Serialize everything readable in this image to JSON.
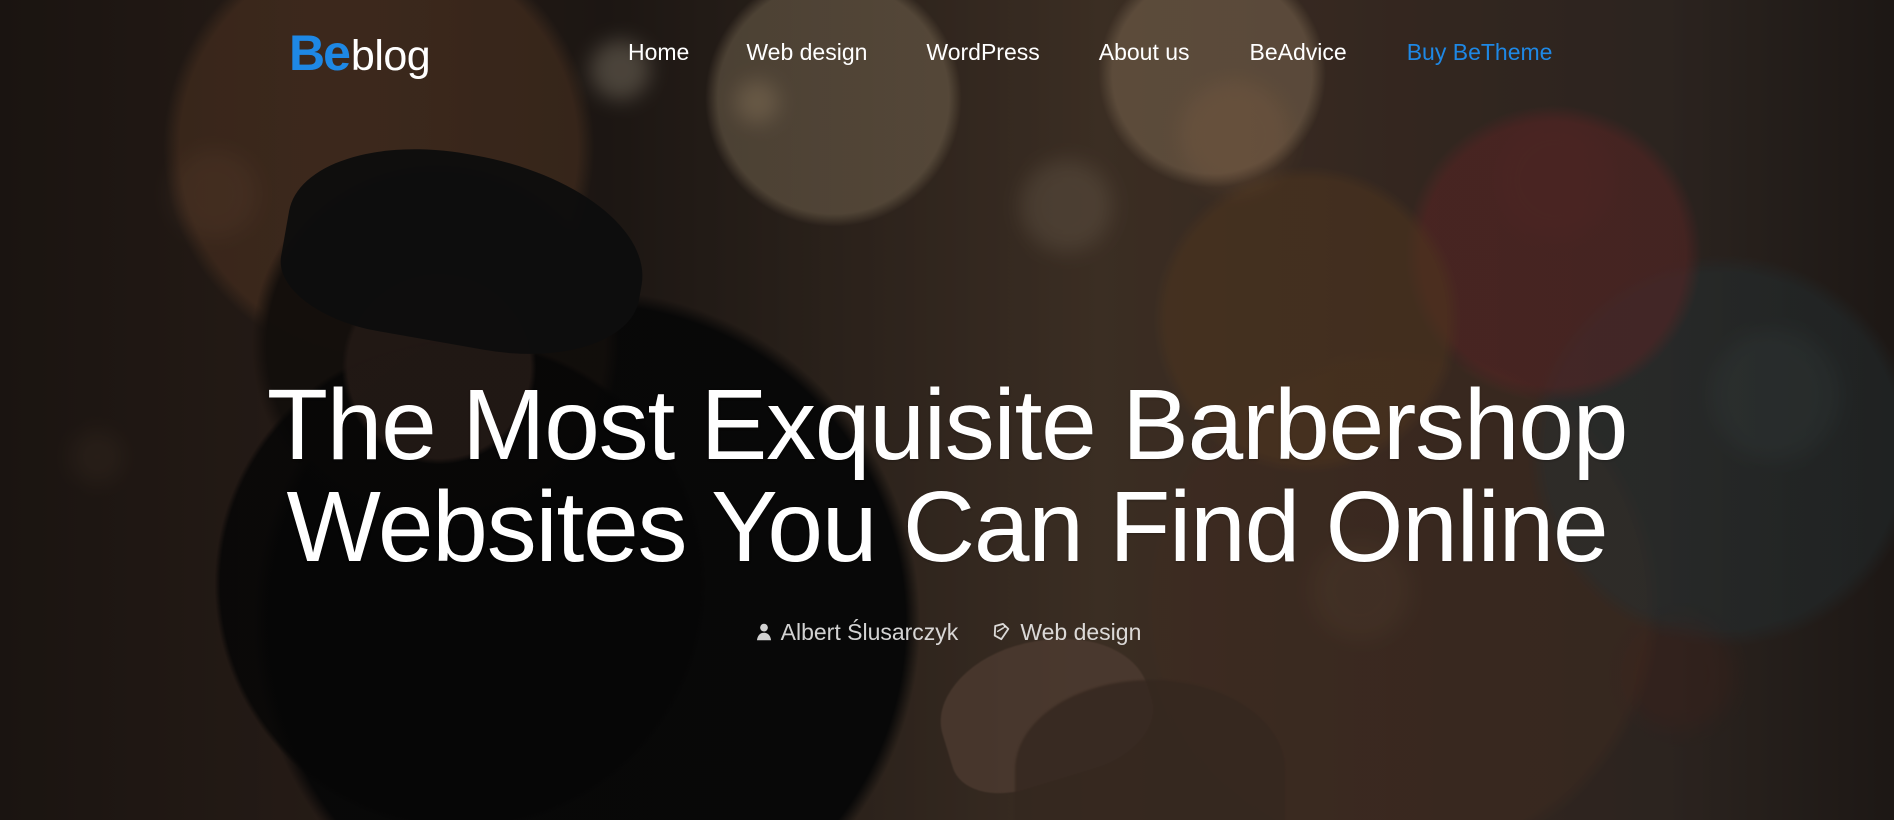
{
  "brand": {
    "logo_primary": "Be",
    "logo_secondary": "blog",
    "accent_color": "#1E88E5"
  },
  "nav": {
    "items": [
      {
        "label": "Home"
      },
      {
        "label": "Web design"
      },
      {
        "label": "WordPress"
      },
      {
        "label": "About us"
      },
      {
        "label": "BeAdvice"
      },
      {
        "label": "Buy BeTheme"
      }
    ]
  },
  "hero": {
    "title_line_1": "The Most Exquisite Barbershop",
    "title_line_2": "Websites You Can Find Online",
    "author": "Albert Ślusarczyk",
    "category": "Web design",
    "author_icon": "user-icon",
    "category_icon": "tag-icon"
  }
}
